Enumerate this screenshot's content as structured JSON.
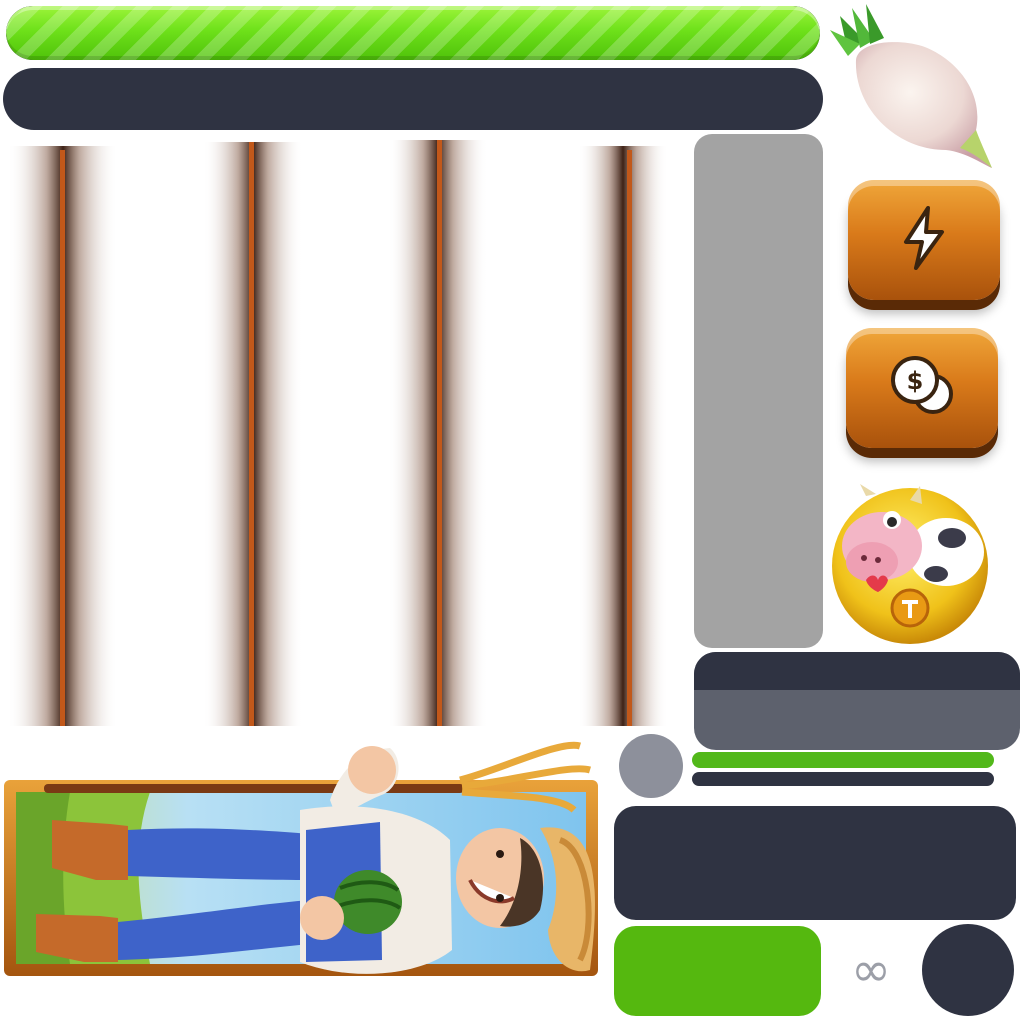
{
  "hud": {
    "energy_progress": 1.0,
    "progress_color": "#6ee11a",
    "track_color": "#2f3342"
  },
  "icons": {
    "crop": "turnip-icon",
    "energy_button": "lightning-icon",
    "coins_button": "dollar-coins-icon",
    "token": "cow-coin-icon",
    "infinity": "infinity-icon"
  },
  "labels": {
    "infinity_symbol": "∞"
  },
  "colors": {
    "button_orange": "#d97a1a",
    "green": "#55b80f",
    "slate": "#2f3342",
    "gray_panel": "#a3a3a3"
  }
}
